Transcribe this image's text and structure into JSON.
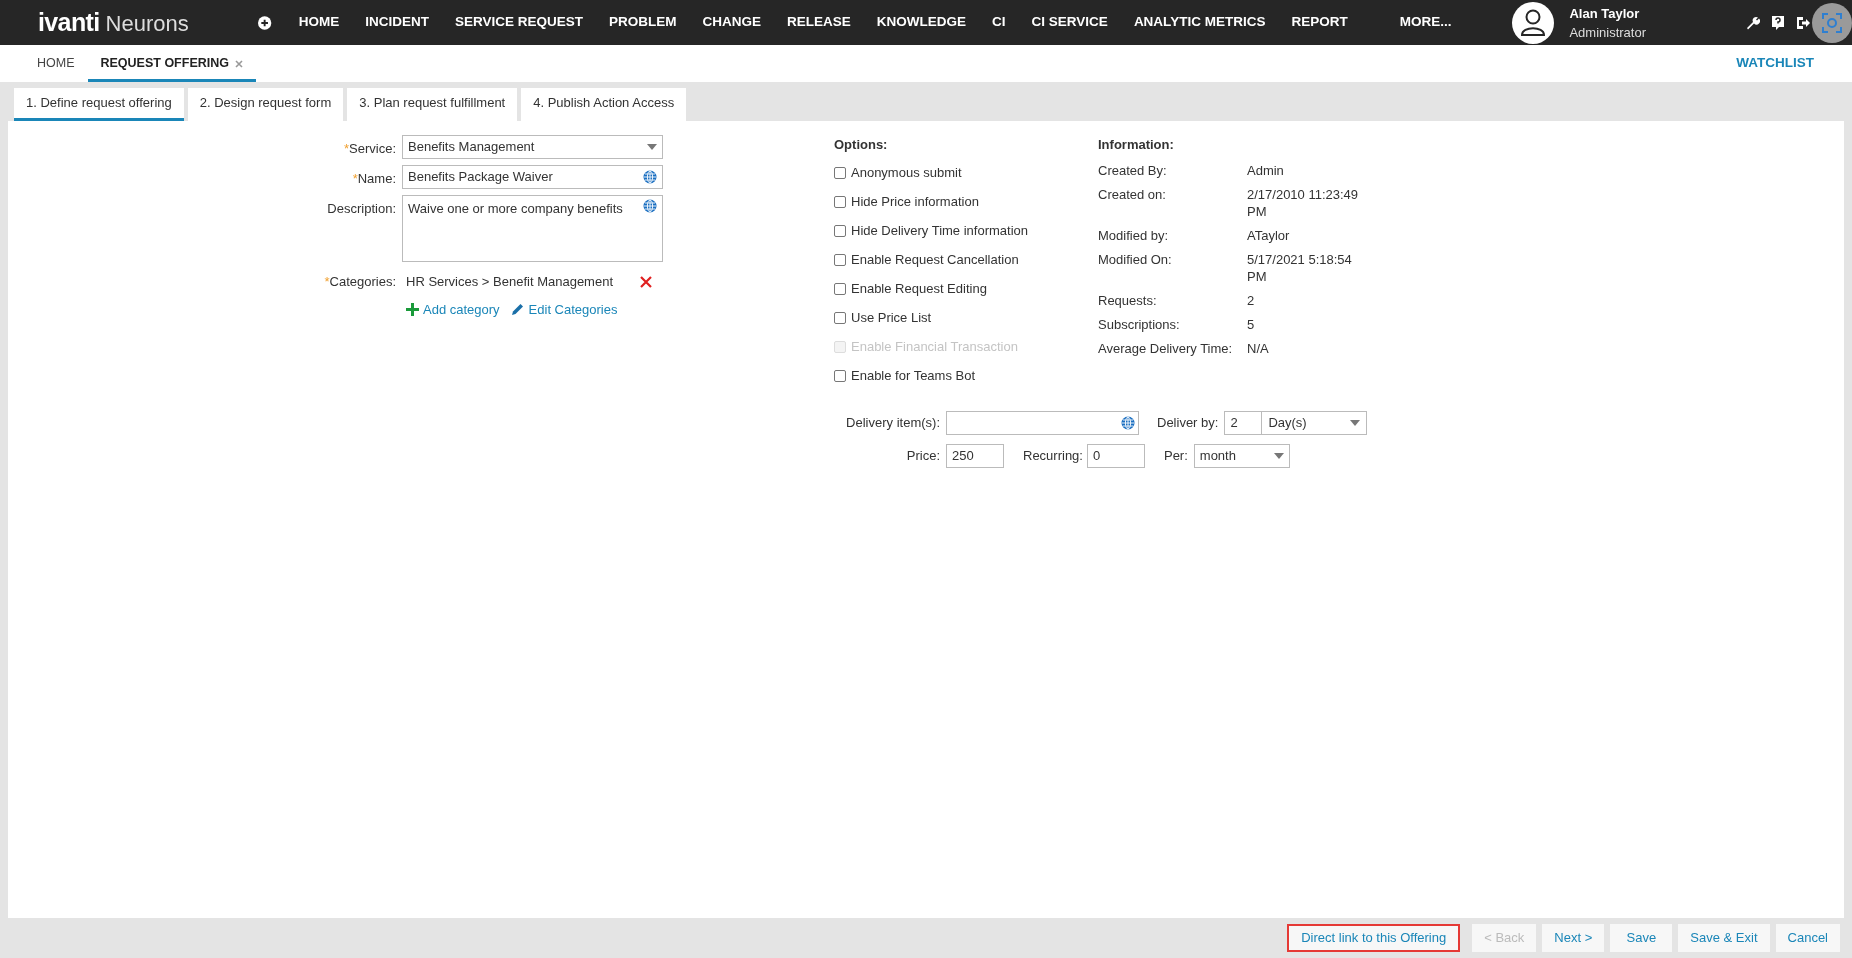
{
  "topbar": {
    "logo": {
      "brand": "ivanti",
      "product": "Neurons"
    },
    "nav": [
      "HOME",
      "INCIDENT",
      "SERVICE REQUEST",
      "PROBLEM",
      "CHANGE",
      "RELEASE",
      "KNOWLEDGE",
      "CI",
      "CI SERVICE",
      "ANALYTIC METRICS",
      "REPORT",
      "MORE..."
    ],
    "user": {
      "name": "Alan Taylor",
      "role": "Administrator"
    }
  },
  "page_tabs": [
    {
      "label": "HOME",
      "selected": false,
      "closable": false
    },
    {
      "label": "REQUEST OFFERING",
      "selected": true,
      "closable": true
    }
  ],
  "watchlist": "WATCHLIST",
  "steps": [
    {
      "label": "1. Define request offering",
      "selected": true
    },
    {
      "label": "2. Design request form",
      "selected": false
    },
    {
      "label": "3. Plan request fulfillment",
      "selected": false
    },
    {
      "label": "4. Publish Action Access",
      "selected": false
    }
  ],
  "form": {
    "fields": [
      {
        "kind": "select",
        "label": "Service:",
        "required_mark": "*",
        "value": "Benefits Management",
        "translatable": false
      },
      {
        "kind": "text",
        "label": "Name:",
        "required_mark": "*",
        "value": "Benefits Package Waiver",
        "translatable": true
      },
      {
        "kind": "textarea",
        "label": "Description:",
        "value": "Waive one or more company benefits",
        "translatable": true
      }
    ],
    "categories": {
      "label": "Categories:",
      "required_mark": "*",
      "value": "HR Services > Benefit Management"
    },
    "links": [
      "Add category",
      "Edit Categories"
    ]
  },
  "options": {
    "title": "Options:",
    "items": [
      {
        "label": "Anonymous submit",
        "checked": false,
        "disabled": false
      },
      {
        "label": "Hide Price information",
        "checked": false,
        "disabled": false
      },
      {
        "label": "Hide Delivery Time information",
        "checked": false,
        "disabled": false
      },
      {
        "label": "Enable Request Cancellation",
        "checked": false,
        "disabled": false
      },
      {
        "label": "Enable Request Editing",
        "checked": false,
        "disabled": false
      },
      {
        "label": "Use Price List",
        "checked": false,
        "disabled": false
      },
      {
        "label": "Enable Financial Transaction",
        "checked": false,
        "disabled": true
      },
      {
        "label": "Enable for Teams Bot",
        "checked": false,
        "disabled": false
      }
    ]
  },
  "information": {
    "title": "Information:",
    "rows": [
      {
        "label": "Created By:",
        "value": "Admin"
      },
      {
        "label": "Created on:",
        "value": "2/17/2010 11:23:49 PM"
      },
      {
        "label": "Modified by:",
        "value": "ATaylor"
      },
      {
        "label": "Modified On:",
        "value": "5/17/2021 5:18:54 PM"
      },
      {
        "label": "Requests:",
        "value": "2"
      },
      {
        "label": "Subscriptions:",
        "value": "5"
      },
      {
        "label": "Average Delivery Time:",
        "value": "N/A"
      }
    ]
  },
  "delivery": {
    "items_label": "Delivery item(s):",
    "deliver_by_label": "Deliver by:",
    "deliver_by_value": "2",
    "deliver_by_unit": "Day(s)",
    "price_label": "Price:",
    "price": "250",
    "recurring_label": "Recurring:",
    "recurring": "0",
    "per_label": "Per:",
    "per": "month"
  },
  "footer_buttons": [
    {
      "label": "Direct link to this Offering",
      "disabled": false,
      "highlighted": true
    },
    {
      "label": "< Back",
      "disabled": true,
      "highlighted": false
    },
    {
      "label": "Next >",
      "disabled": false,
      "highlighted": false
    },
    {
      "label": "Save",
      "disabled": false,
      "highlighted": false
    },
    {
      "label": "Save & Exit",
      "disabled": false,
      "highlighted": false
    },
    {
      "label": "Cancel",
      "disabled": false,
      "highlighted": false
    }
  ]
}
